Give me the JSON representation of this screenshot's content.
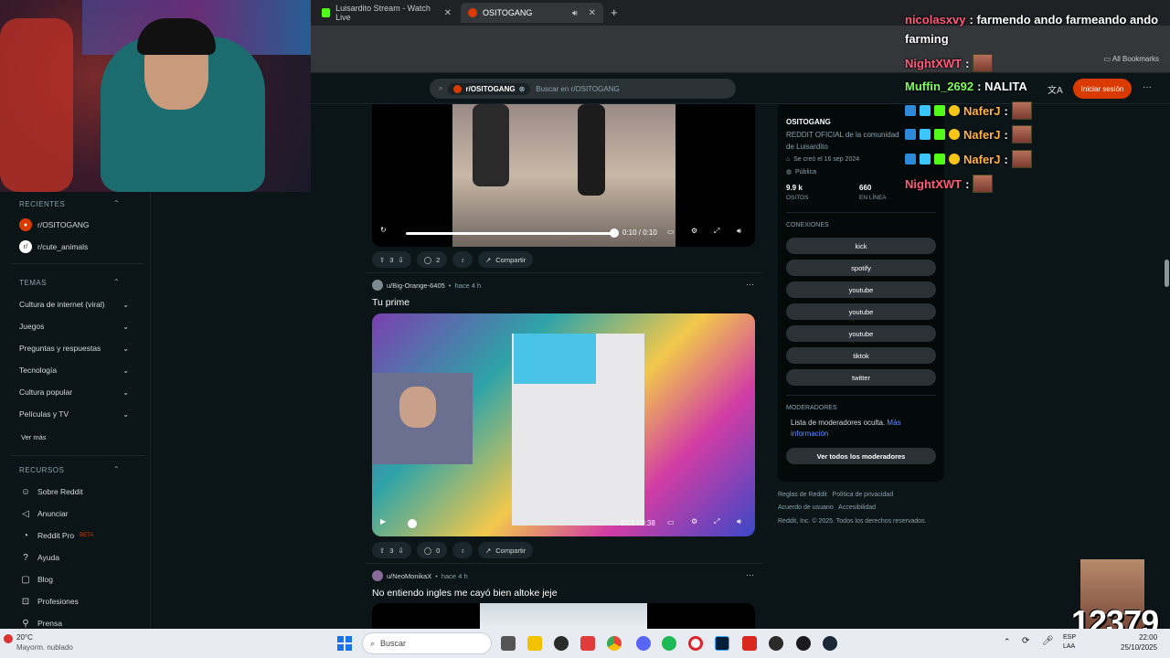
{
  "browser": {
    "tabs": [
      {
        "label": "Luisardito Stream - Watch Live",
        "icon_color": "#53fc18"
      },
      {
        "label": "OSITOGANG",
        "icon_color": "#d93a00"
      }
    ],
    "bookmarks_all": "All Bookmarks"
  },
  "header": {
    "search_chip": "r/OSITOGANG",
    "search_placeholder": "Buscar en r/OSITOGANG",
    "login_label": "Iniciar sesión"
  },
  "sidebar": {
    "recientes_title": "RECIENTES",
    "recent": [
      "r/OSITOGANG",
      "r/cute_animals"
    ],
    "temas_title": "TEMAS",
    "topics": [
      "Cultura de internet (viral)",
      "Juegos",
      "Preguntas y respuestas",
      "Tecnología",
      "Cultura popular",
      "Películas y TV"
    ],
    "ver_mas": "Ver más",
    "recursos_title": "RECURSOS",
    "resources": [
      {
        "label": "Sobre Reddit",
        "icon": "reddit-icon"
      },
      {
        "label": "Anunciar",
        "icon": "megaphone-icon"
      },
      {
        "label": "Reddit Pro",
        "icon": "pro-icon",
        "badge": "BETA"
      },
      {
        "label": "Ayuda",
        "icon": "help-icon"
      },
      {
        "label": "Blog",
        "icon": "blog-icon"
      },
      {
        "label": "Profesiones",
        "icon": "briefcase-icon"
      },
      {
        "label": "Prensa",
        "icon": "press-icon"
      }
    ]
  },
  "posts": [
    {
      "time": "0:10 / 0:10",
      "progress": 1.0,
      "votes": "3",
      "comments": "2",
      "share": "Compartir"
    },
    {
      "author": "u/Big-Orange-6405",
      "age": "hace 4 h",
      "title": "Tu prime",
      "time": "0:01 / 0:38",
      "progress": 0.03,
      "votes": "3",
      "comments": "0",
      "share": "Compartir"
    },
    {
      "author": "u/NeoMonikaX",
      "age": "hace 4 h",
      "title": "No entiendo ingles me cayó bien altoke jeje"
    }
  ],
  "community": {
    "name": "OSITOGANG",
    "description": "REDDIT OFICIAL de la comunidad de Luisardito",
    "created": "Se creó el 16 sep 2024",
    "visibility": "Pública",
    "members_value": "9.9 k",
    "members_label": "OSITOS",
    "online_value": "660",
    "online_label": "EN LÍNEA",
    "connections_title": "CONEXIONES",
    "links": [
      "kick",
      "spotify",
      "youtube",
      "youtube",
      "youtube",
      "tiktok",
      "twitter"
    ],
    "mods_title": "MODERADORES",
    "mods_text": "Lista de moderadores oculta.",
    "mods_more": "Más información",
    "mods_button": "Ver todos los moderadores"
  },
  "footer": {
    "rules": "Reglas de Reddit",
    "privacy": "Política de privacidad",
    "agreement": "Acuerdo de usuario",
    "accessibility": "Accesibilidad",
    "copyright": "Reddit, Inc. © 2025. Todos los derechos reservados."
  },
  "chat": [
    {
      "user": "nicolasxvy",
      "user_color": "#ff5a7a",
      "text": ": farmendo ando farmeando ando",
      "text2": "farming"
    },
    {
      "user": "NightXWT",
      "user_color": "#ff5a7a",
      "text": ":"
    },
    {
      "user": "Muffin_2692",
      "user_color": "#7cfc5a",
      "text": ": NALITA"
    },
    {
      "user": "NaferJ",
      "user_color": "#ffb347",
      "text": ":"
    },
    {
      "user": "NaferJ",
      "user_color": "#ffb347",
      "text": ":"
    },
    {
      "user": "NaferJ",
      "user_color": "#ffb347",
      "text": ":"
    },
    {
      "user": "NightXWT",
      "user_color": "#ff5a7a",
      "text": ":"
    }
  ],
  "overlay_counter": "12379",
  "taskbar": {
    "weather_temp": "20°C",
    "weather_desc": "Mayorm. nublado",
    "search_label": "Buscar",
    "lang": "ESP",
    "lang2": "LAA",
    "time": "22:00",
    "date": "25/10/2025"
  }
}
